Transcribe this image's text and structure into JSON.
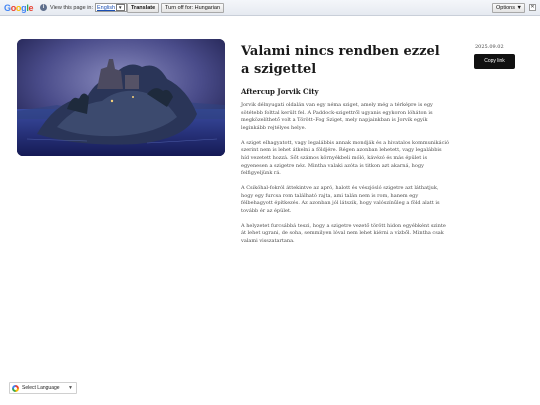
{
  "translate_bar": {
    "logo_letters": [
      "G",
      "o",
      "o",
      "g",
      "l",
      "e"
    ],
    "info_glyph": "i",
    "view_text": "View this page in:",
    "language": "English",
    "dropdown_glyph": "▼",
    "translate_label": "Translate",
    "turn_off_label": "Turn off for: Hungarian",
    "options_label": "Options ▼",
    "close_glyph": "✕"
  },
  "article": {
    "title": "Valami nincs rendben ezzel a szigettel",
    "subtitle": "Aftercup Jorvik City",
    "paragraphs": [
      "Jorvik délnyugati oldalán van egy néma sziget, amely még a térképre is egy sötétebb folttal került fel. A Paddock-szigettről ugyanis egykoron lóháton is megközelíthető volt a Törött–Fog Sziget, mely napjainkban is Jorvik egyik leginkább rejtélyes helye.",
      "A sziget elhagyatott, vagy legalábbis annak mondják és a hivatalos kommunikáció szerint nem is lehet átkelni a földjére. Régen azonban lehetett, vagy legalábbis híd vezetett hozzá. Sőt számos környékbeli móló, kávézó és más épület is egyenesen a szigetre néz. Mintha valaki azóta is titkon azt akarná, hogy felfigyeljünk rá.",
      "A Csiköhal-fokról áttekintve az apró, halott és vészjósló szigetre azt láthatjuk, hogy egy furcsa rom található rajta, ami talán nem is rom, hanem egy félbehagyott építkezés. Az azonban jól látszik, hogy valószínűleg a föld alatt is tovább ér az épület.",
      "A helyzetet furcsábbá teszi, hogy a szigetre vezető törött hidon egyébként szinte át lehet ugrani, de soha, semmilyen lóval nem lehet kiérni a vízből. Mintha csak valami visszatartana."
    ]
  },
  "sidebar": {
    "date": "2025.09.02",
    "copy_link_label": "Copy link"
  },
  "language_widget": {
    "label": "Select Language",
    "arrow": "▼"
  },
  "colors": {
    "button_dark": "#111111",
    "link_blue": "#1a4fb4",
    "hero_night": "#3b3d78"
  }
}
